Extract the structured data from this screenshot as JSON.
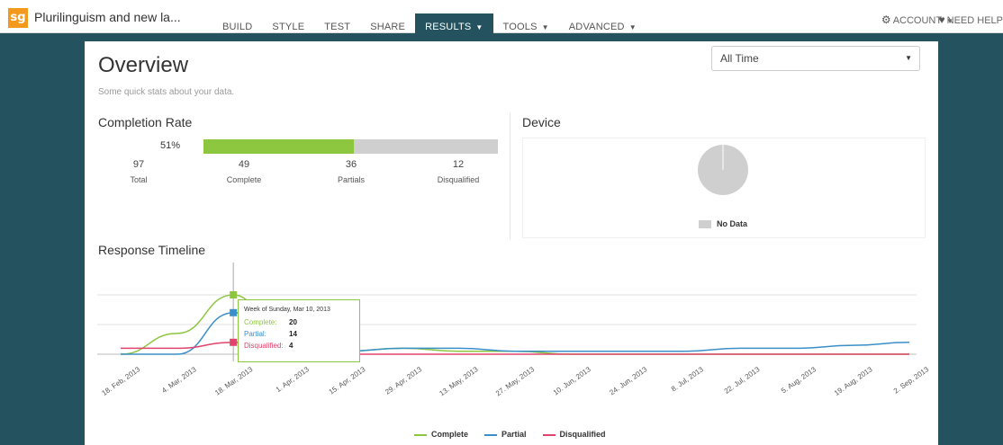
{
  "app": {
    "logo": "sg",
    "survey_title": "Plurilinguism and new la..."
  },
  "nav": [
    {
      "label": "BUILD",
      "dropdown": false,
      "active": false
    },
    {
      "label": "STYLE",
      "dropdown": false,
      "active": false
    },
    {
      "label": "TEST",
      "dropdown": false,
      "active": false
    },
    {
      "label": "SHARE",
      "dropdown": false,
      "active": false
    },
    {
      "label": "RESULTS",
      "dropdown": true,
      "active": true
    },
    {
      "label": "TOOLS",
      "dropdown": true,
      "active": false
    },
    {
      "label": "ADVANCED",
      "dropdown": true,
      "active": false
    }
  ],
  "account": {
    "label": "ACCOUNT",
    "icon": "gear-icon"
  },
  "help": {
    "label": "NEED HELP",
    "icon": "heart-icon"
  },
  "overview": {
    "title": "Overview",
    "subtitle": "Some quick stats about your data."
  },
  "time_filter": {
    "selected": "All Time"
  },
  "completion": {
    "title": "Completion Rate",
    "percent_label": "51%",
    "percent": 51,
    "stats": [
      {
        "value": "97",
        "label": "Total"
      },
      {
        "value": "49",
        "label": "Complete"
      },
      {
        "value": "36",
        "label": "Partials"
      },
      {
        "value": "12",
        "label": "Disqualified"
      }
    ]
  },
  "device": {
    "title": "Device",
    "legend": "No Data"
  },
  "timeline": {
    "title": "Response Timeline"
  },
  "tooltip": {
    "heading": "Week of Sunday, Mar 10, 2013",
    "rows": [
      {
        "label": "Complete:",
        "value": "20",
        "color": "#8dc63f"
      },
      {
        "label": "Partial:",
        "value": "14",
        "color": "#3a8fc8"
      },
      {
        "label": "Disqualified:",
        "value": "4",
        "color": "#e0436b"
      }
    ]
  },
  "chart_data": {
    "type": "line",
    "x": [
      "18. Feb, 2013",
      "4. Mar, 2013",
      "18. Mar, 2013",
      "1. Apr, 2013",
      "15. Apr, 2013",
      "29. Apr, 2013",
      "13. May, 2013",
      "27. May, 2013",
      "10. Jun, 2013",
      "24. Jun, 2013",
      "8. Jul, 2013",
      "22. Jul, 2013",
      "5. Aug, 2013",
      "19. Aug, 2013",
      "2. Sep, 2013"
    ],
    "series": [
      {
        "name": "Complete",
        "color": "#8dc63f",
        "values": [
          0,
          7,
          20,
          1,
          1,
          2,
          1,
          1,
          0,
          0,
          0,
          0,
          0,
          0,
          0
        ]
      },
      {
        "name": "Partial",
        "color": "#3a8fc8",
        "values": [
          0,
          0,
          14,
          1,
          1,
          2,
          2,
          1,
          1,
          1,
          1,
          2,
          2,
          3,
          4
        ]
      },
      {
        "name": "Disqualified",
        "color": "#e0436b",
        "values": [
          2,
          2,
          4,
          2,
          0,
          0,
          0,
          0,
          0,
          0,
          0,
          0,
          0,
          0,
          0
        ]
      }
    ],
    "ylim": [
      0,
      20
    ]
  },
  "legend": [
    {
      "name": "Complete",
      "color": "#8dc63f"
    },
    {
      "name": "Partial",
      "color": "#3a8fc8"
    },
    {
      "name": "Disqualified",
      "color": "#e0436b"
    }
  ]
}
